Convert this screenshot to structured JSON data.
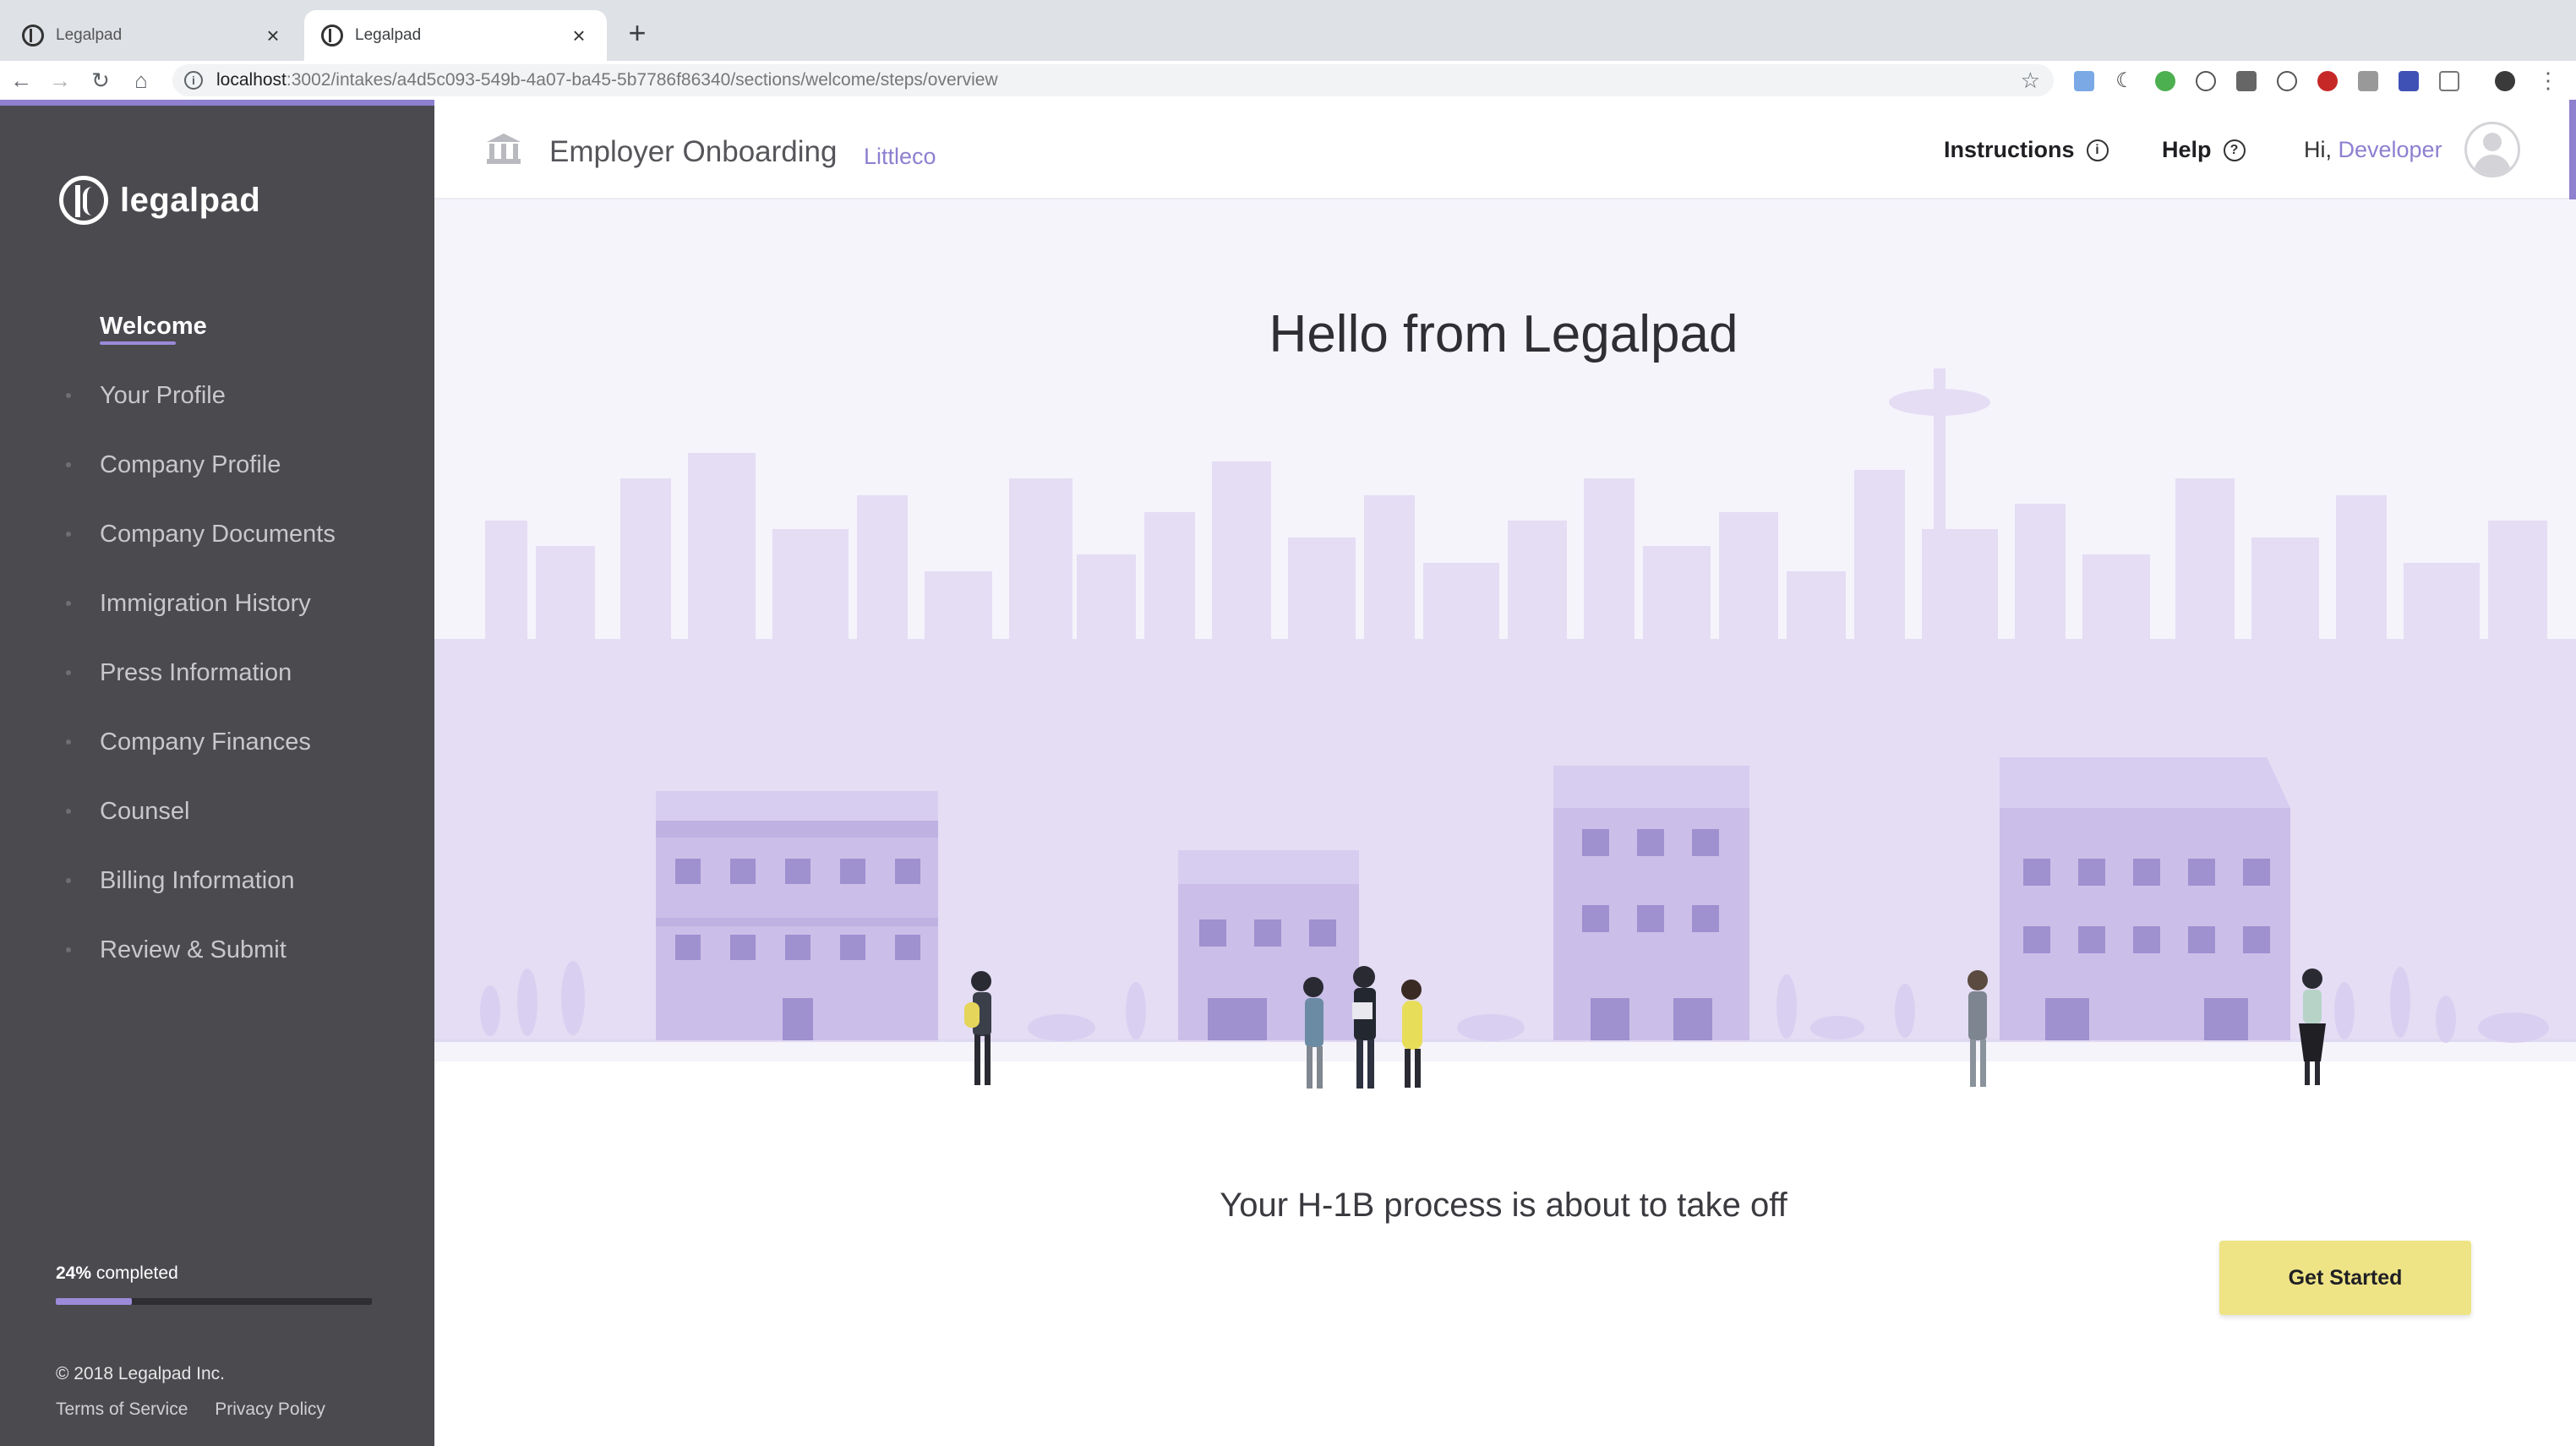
{
  "browser": {
    "tabs": [
      {
        "title": "Legalpad",
        "active": false
      },
      {
        "title": "Legalpad",
        "active": true
      }
    ],
    "new_tab_label": "+",
    "url_host": "localhost",
    "url_rest": ":3002/intakes/a4d5c093-549b-4a07-ba45-5b7786f86340/sections/welcome/steps/overview"
  },
  "sidebar": {
    "logo_text": "legalpad",
    "items": [
      {
        "label": "Welcome",
        "active": true
      },
      {
        "label": "Your Profile",
        "active": false
      },
      {
        "label": "Company Profile",
        "active": false
      },
      {
        "label": "Company Documents",
        "active": false
      },
      {
        "label": "Immigration History",
        "active": false
      },
      {
        "label": "Press Information",
        "active": false
      },
      {
        "label": "Company Finances",
        "active": false
      },
      {
        "label": "Counsel",
        "active": false
      },
      {
        "label": "Billing Information",
        "active": false
      },
      {
        "label": "Review & Submit",
        "active": false
      }
    ],
    "progress": {
      "percent_label": "24%",
      "suffix": " completed",
      "fraction": 0.24
    },
    "copyright": "© 2018 Legalpad Inc.",
    "terms": "Terms of Service",
    "privacy": "Privacy Policy"
  },
  "header": {
    "title": "Employer Onboarding",
    "company": "Littleco",
    "instructions": "Instructions",
    "help": "Help",
    "greeting": "Hi, ",
    "user": "Developer"
  },
  "main": {
    "hero_title": "Hello from Legalpad",
    "subtitle": "Your H-1B process is about to take off",
    "cta": "Get Started"
  },
  "colors": {
    "accent": "#8e7fd0",
    "sidebar_bg": "#4a4a4f",
    "cta_bg": "#eee486",
    "skyline": "#e6e0f5",
    "building": "#cbbfe9"
  }
}
